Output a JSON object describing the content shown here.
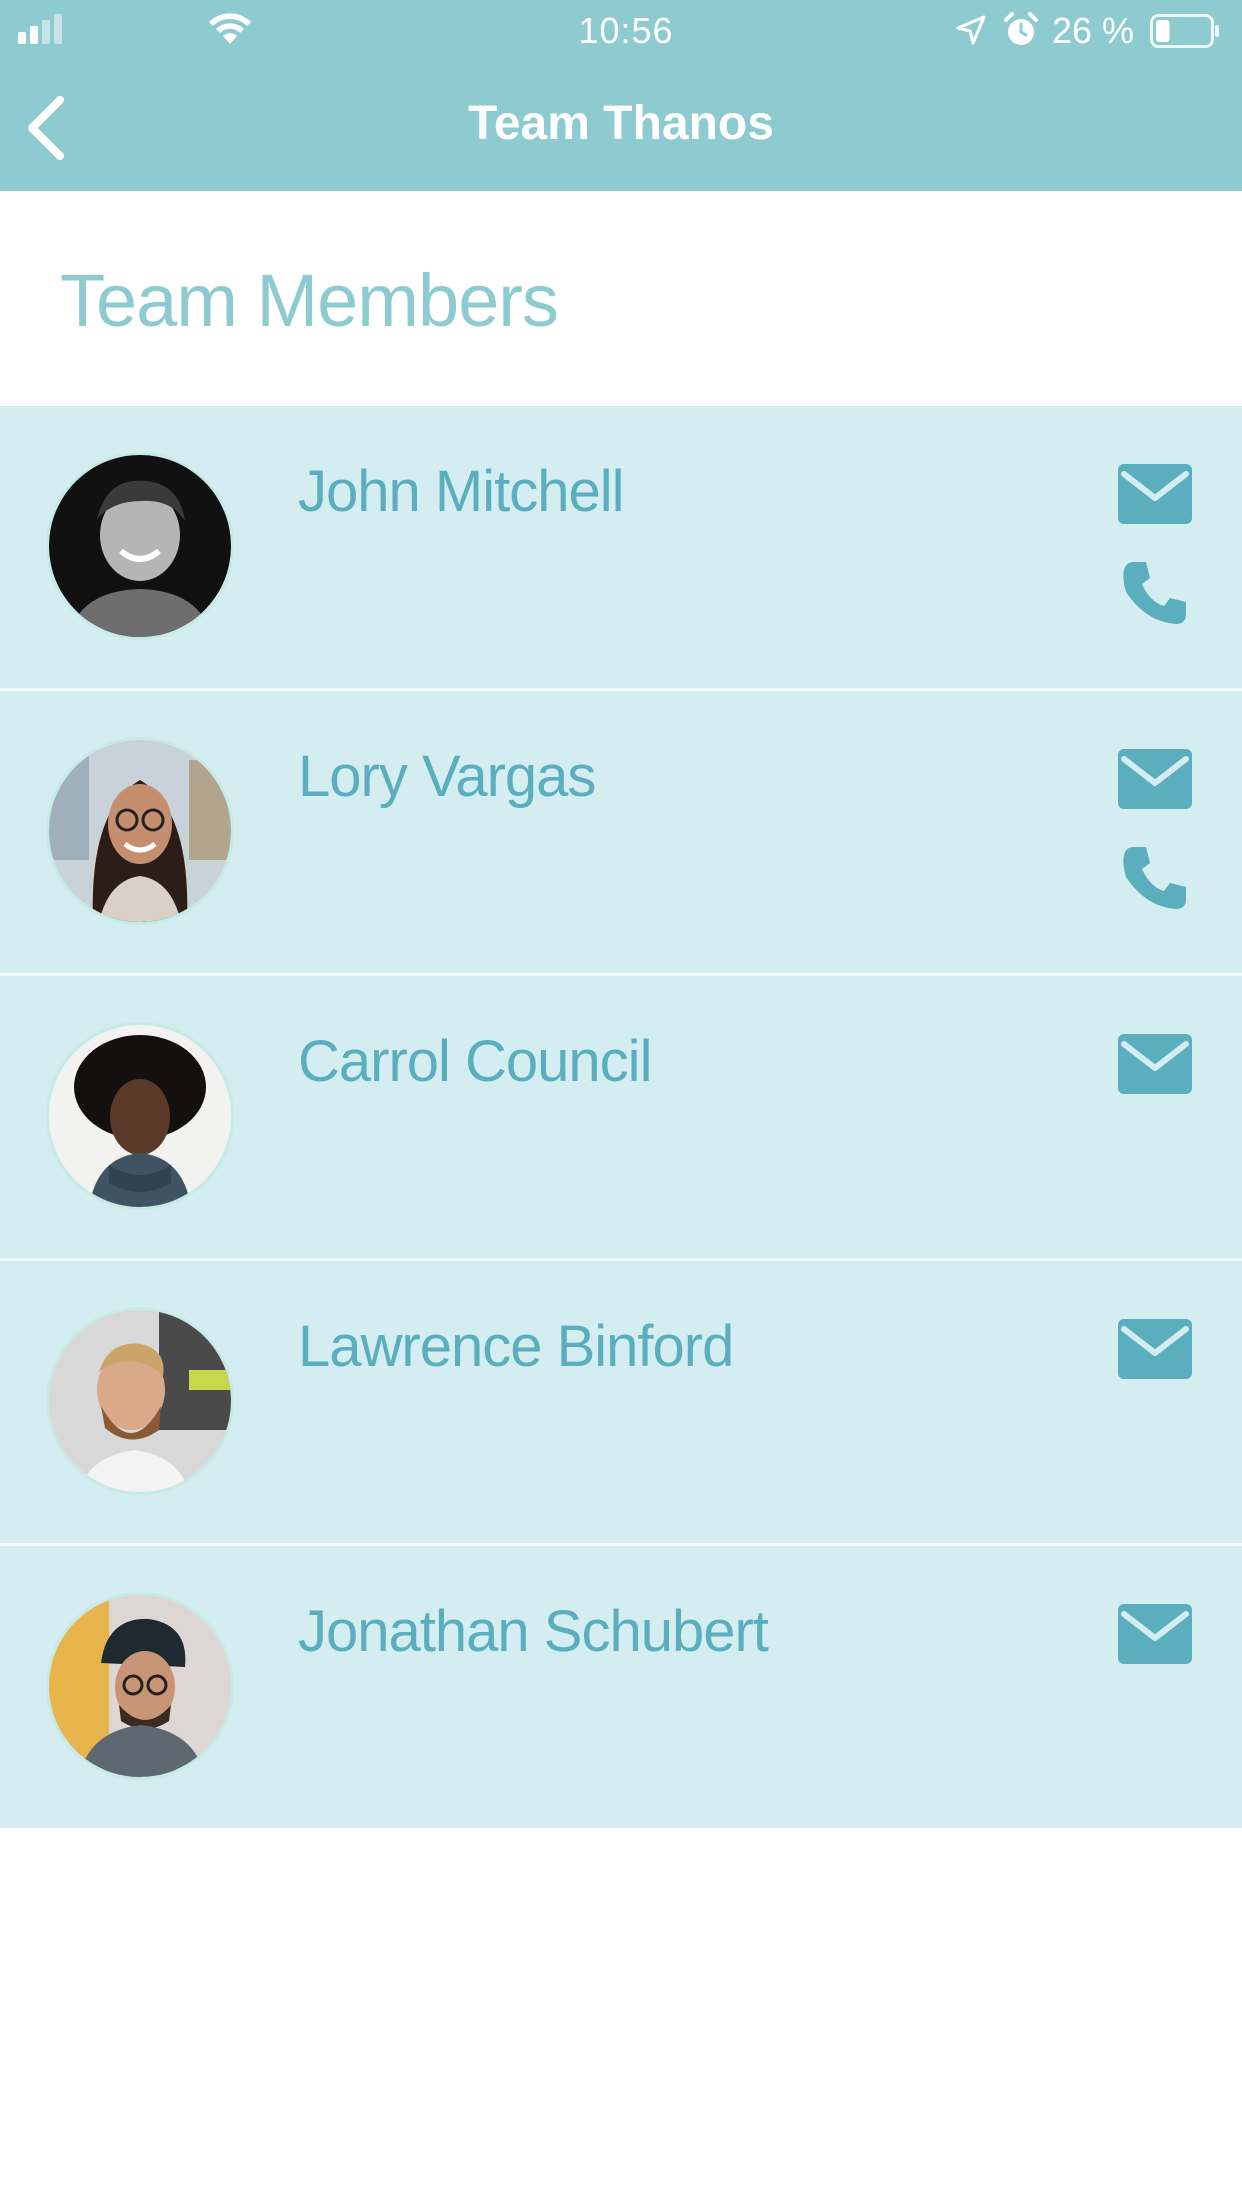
{
  "status_bar": {
    "time": "10:56",
    "battery_percent": "26 %",
    "battery_level": 0.26
  },
  "nav": {
    "title": "Team Thanos",
    "back_icon": "chevron-left-icon"
  },
  "section": {
    "title": "Team Members"
  },
  "colors": {
    "header_bg": "#8ecbd1",
    "row_bg": "#d4edf0",
    "accent": "#5aaebd"
  },
  "members": [
    {
      "name": "John Mitchell",
      "has_phone": true
    },
    {
      "name": "Lory Vargas",
      "has_phone": true
    },
    {
      "name": "Carrol Council",
      "has_phone": false
    },
    {
      "name": "Lawrence Binford",
      "has_phone": false
    },
    {
      "name": "Jonathan Schubert",
      "has_phone": false
    }
  ]
}
